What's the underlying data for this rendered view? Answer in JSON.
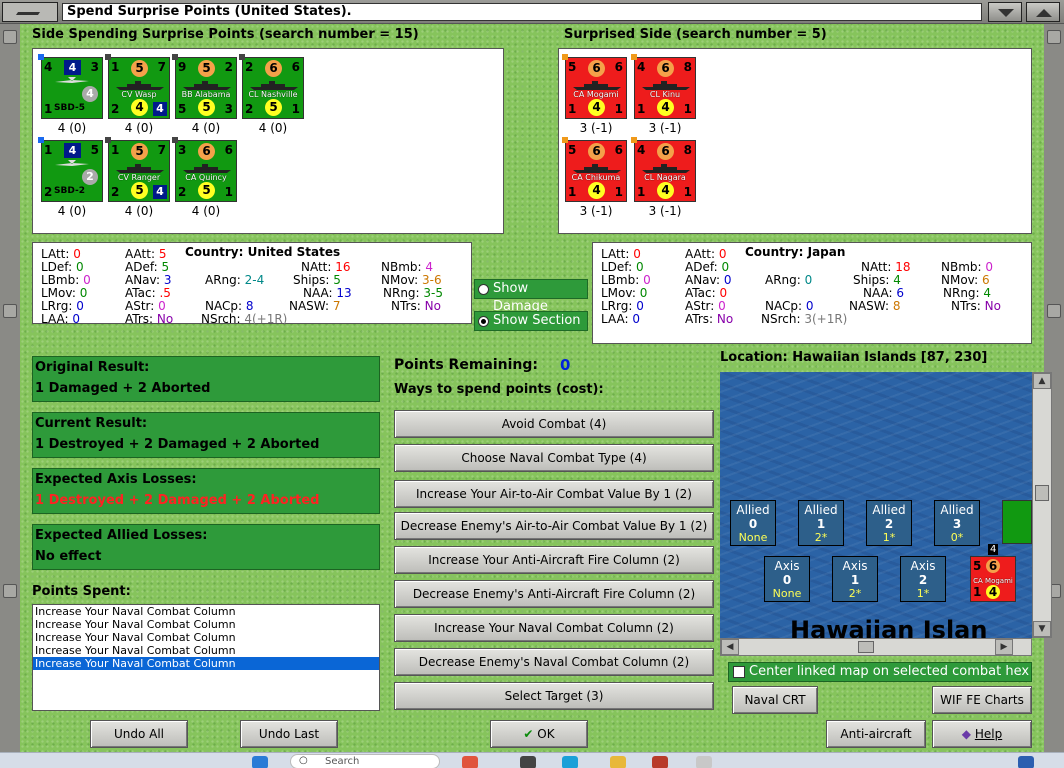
{
  "window": {
    "title": "Spend Surprise Points (United States)."
  },
  "spending": {
    "header": "Side Spending Surprise Points (search number = 15)",
    "units": [
      {
        "tl": "4",
        "top": "4",
        "tr": "3",
        "bl": "1",
        "br": "",
        "name": "SBD-5",
        "circle": "4",
        "label": "4 (0)"
      },
      {
        "tl": "1",
        "top": "5",
        "tr": "7",
        "bl": "2",
        "bot": "4",
        "br": "4",
        "name": "CV Wasp",
        "label": "4 (0)"
      },
      {
        "tl": "9",
        "top": "5",
        "tr": "2",
        "bl": "5",
        "bot": "5",
        "br": "3",
        "name": "BB Alabama",
        "label": "4 (0)"
      },
      {
        "tl": "2",
        "top": "6",
        "tr": "6",
        "bl": "2",
        "bot": "5",
        "br": "1",
        "name": "CL Nashville",
        "label": "4 (0)"
      },
      {
        "tl": "1",
        "top": "4",
        "tr": "5",
        "bl": "2",
        "br": "",
        "name": "SBD-2",
        "circle": "2",
        "label": "4 (0)"
      },
      {
        "tl": "1",
        "top": "5",
        "tr": "7",
        "bl": "2",
        "bot": "5",
        "br": "4",
        "name": "CV Ranger",
        "label": "4 (0)"
      },
      {
        "tl": "3",
        "top": "6",
        "tr": "6",
        "bl": "2",
        "bot": "5",
        "br": "1",
        "name": "CA Quincy",
        "label": "4 (0)"
      }
    ]
  },
  "surprised": {
    "header": "Surprised Side (search number = 5)",
    "units": [
      {
        "tl": "5",
        "top": "6",
        "tr": "6",
        "bl": "1",
        "bot": "4",
        "br": "1",
        "name": "CA Mogami",
        "label": "3 (-1)"
      },
      {
        "tl": "4",
        "top": "6",
        "tr": "8",
        "bl": "1",
        "bot": "4",
        "br": "1",
        "name": "CL Kinu",
        "label": "3 (-1)"
      },
      {
        "tl": "5",
        "top": "6",
        "tr": "6",
        "bl": "1",
        "bot": "4",
        "br": "1",
        "name": "CA Chikuma",
        "label": "3 (-1)"
      },
      {
        "tl": "4",
        "top": "6",
        "tr": "8",
        "bl": "1",
        "bot": "4",
        "br": "1",
        "name": "CL Nagara",
        "label": "3 (-1)"
      }
    ]
  },
  "us_stats": {
    "country_label": "Country:",
    "country": "United States",
    "LAtt": "0",
    "LDef": "0",
    "LBmb": "0",
    "LMov": "0",
    "LRrg": "0",
    "LAA": "0",
    "AAtt": "5",
    "ADef": "5",
    "ANav": "3",
    "ATac": ".5",
    "AStr": "0",
    "ATrs": "No",
    "ARng": "2-4",
    "NACp": "8",
    "NSrch": "4(+1R)",
    "NAtt": "16",
    "Ships": "5",
    "NAA": "13",
    "NASW": "7",
    "NBmb": "4",
    "NMov": "3-6",
    "NRng": "3-5",
    "NTrs": "No"
  },
  "jp_stats": {
    "country_label": "Country:",
    "country": "Japan",
    "LAtt": "0",
    "LDef": "0",
    "LBmb": "0",
    "LMov": "0",
    "LRrg": "0",
    "LAA": "0",
    "AAtt": "0",
    "ADef": "0",
    "ANav": "0",
    "ATac": "0",
    "AStr": "0",
    "ATrs": "No",
    "ARng": "0",
    "NACp": "0",
    "NSrch": "3(+1R)",
    "NAtt": "18",
    "Ships": "4",
    "NAA": "6",
    "NASW": "8",
    "NBmb": "0",
    "NMov": "6",
    "NRng": "4",
    "NTrs": "No"
  },
  "toggles": {
    "show_damage": "Show Damage",
    "show_section": "Show Section"
  },
  "results": {
    "original_label": "Original Result:",
    "original": "1 Damaged + 2 Aborted",
    "current_label": "Current Result:",
    "current": "1 Destroyed + 2 Damaged + 2 Aborted",
    "axis_label": "Expected Axis Losses:",
    "axis": "1 Destroyed + 2 Damaged + 2 Aborted",
    "allied_label": "Expected Allied Losses:",
    "allied": "No effect"
  },
  "points": {
    "remaining_label": "Points Remaining:",
    "remaining": "0",
    "ways_label": "Ways to spend points (cost):",
    "options": [
      "Avoid Combat (4)",
      "Choose Naval Combat Type (4)",
      "Increase Your Air-to-Air Combat Value By 1 (2)",
      "Decrease Enemy's Air-to-Air Combat Value By 1 (2)",
      "Increase Your Anti-Aircraft Fire Column (2)",
      "Decrease Enemy's Anti-Aircraft Fire Column (2)",
      "Increase Your Naval Combat Column (2)",
      "Decrease Enemy's Naval Combat Column (2)",
      "Select Target (3)"
    ],
    "spent_label": "Points Spent:",
    "spent": [
      "Increase Your Naval Combat Column",
      "Increase Your Naval Combat Column",
      "Increase Your Naval Combat Column",
      "Increase Your Naval Combat Column",
      "Increase Your Naval Combat Column"
    ]
  },
  "location": {
    "label": "Location: Hawaiian Islands [87, 230]",
    "map_text": "Hawaiian Islan",
    "allied": [
      {
        "side": "Allied",
        "num": "0",
        "sub": "None"
      },
      {
        "side": "Allied",
        "num": "1",
        "sub": "2*"
      },
      {
        "side": "Allied",
        "num": "2",
        "sub": "1*"
      },
      {
        "side": "Allied",
        "num": "3",
        "sub": "0*"
      }
    ],
    "axis": [
      {
        "side": "Axis",
        "num": "0",
        "sub": "None"
      },
      {
        "side": "Axis",
        "num": "1",
        "sub": "2*"
      },
      {
        "side": "Axis",
        "num": "2",
        "sub": "1*"
      }
    ],
    "map_counter": {
      "tl": "5",
      "top": "6",
      "name": "CA Mogami",
      "bl": "1",
      "bot": "4",
      "br": "1",
      "stack": "4"
    },
    "center_check": "Center linked map on selected combat hex"
  },
  "buttons": {
    "naval_crt": "Naval CRT",
    "wif_charts": "WIF FE Charts",
    "undo_all": "Undo All",
    "undo_last": "Undo Last",
    "ok": "OK",
    "aa_crt": "Anti-aircraft CRT",
    "help": "Help"
  },
  "taskbar": {
    "search": "Search"
  },
  "colors": {
    "us_counter": "#119911",
    "jp_counter": "#ee1c1c",
    "grass": "#86c45c",
    "result_box": "#2e9a3a",
    "selected": "#0a66d6"
  }
}
